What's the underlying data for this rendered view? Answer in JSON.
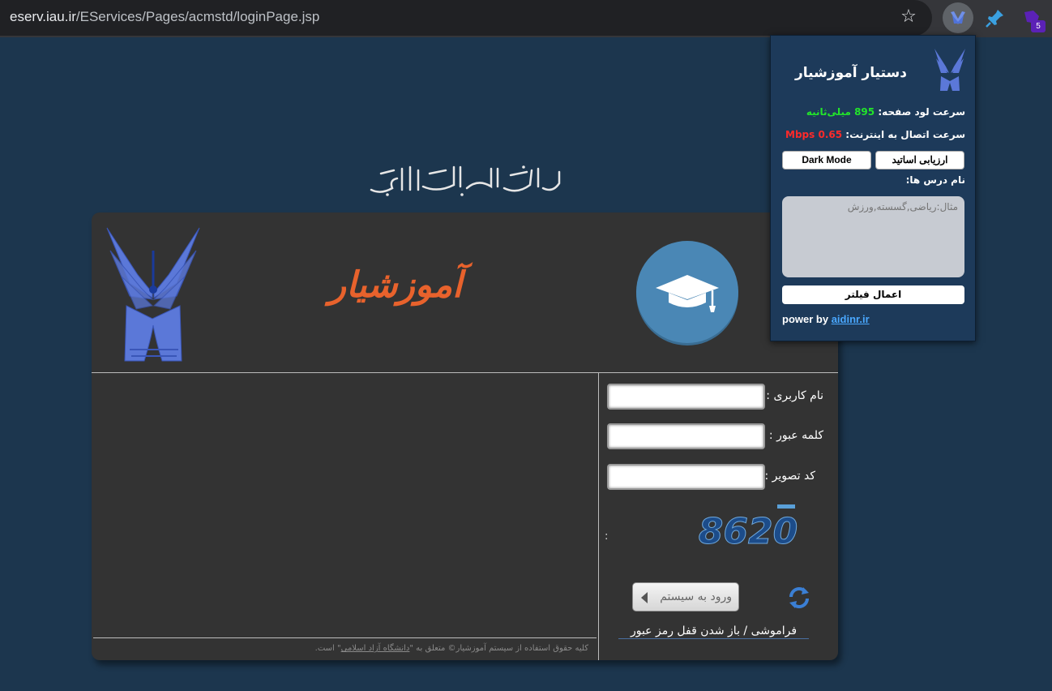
{
  "browser": {
    "url_host": "eserv.iau.ir",
    "url_path": "/EServices/Pages/acmstd/loginPage.jsp",
    "extension_badge": "5"
  },
  "header": {
    "bismillah": "بسم الله الرحمن الرحیم",
    "brand_title": "آموزشیار"
  },
  "login": {
    "username_label": "نام کاربری :",
    "password_label": "کلمه عبور :",
    "captcha_label": "کد تصویر :",
    "captcha_code": "8620",
    "login_button": "ورود به سیستم",
    "forgot_link": "فراموشی / باز شدن قفل رمز عبور",
    "copyright_prefix": "کلیه حقوق استفاده از سیستم آموزشیار© متعلق به \"",
    "copyright_university": "دانشگاه آزاد اسلامی",
    "copyright_suffix": "\" است."
  },
  "popup": {
    "title": "دستیار آموزشیار",
    "load_speed_label": "سرعت لود صفحه:",
    "load_speed_value": "895 میلی‌ثانیه",
    "net_speed_label": "سرعت اتصال به اینترنت:",
    "net_speed_value": "0.65 Mbps",
    "eval_button": "ارزیابی اساتید",
    "dark_button": "Dark Mode",
    "courses_label": "نام درس ها:",
    "courses_placeholder": "مثال:ریاضی,گسسته,ورزش",
    "apply_button": "اعمال فیلتر",
    "power_by": "power by",
    "power_link": "aidinr.ir"
  },
  "colors": {
    "page_bg": "#1c364e",
    "panel_bg": "#333333",
    "brand_orange": "#e8622c",
    "popup_bg": "#1d3a5a",
    "green": "#22e52a",
    "red": "#ff2a2a"
  },
  "icons": [
    "star-icon",
    "iau-extension-icon",
    "pin-extension-icon",
    "puzzle-extension-icon",
    "graduation-cap-icon",
    "refresh-icon",
    "iau-logo"
  ]
}
